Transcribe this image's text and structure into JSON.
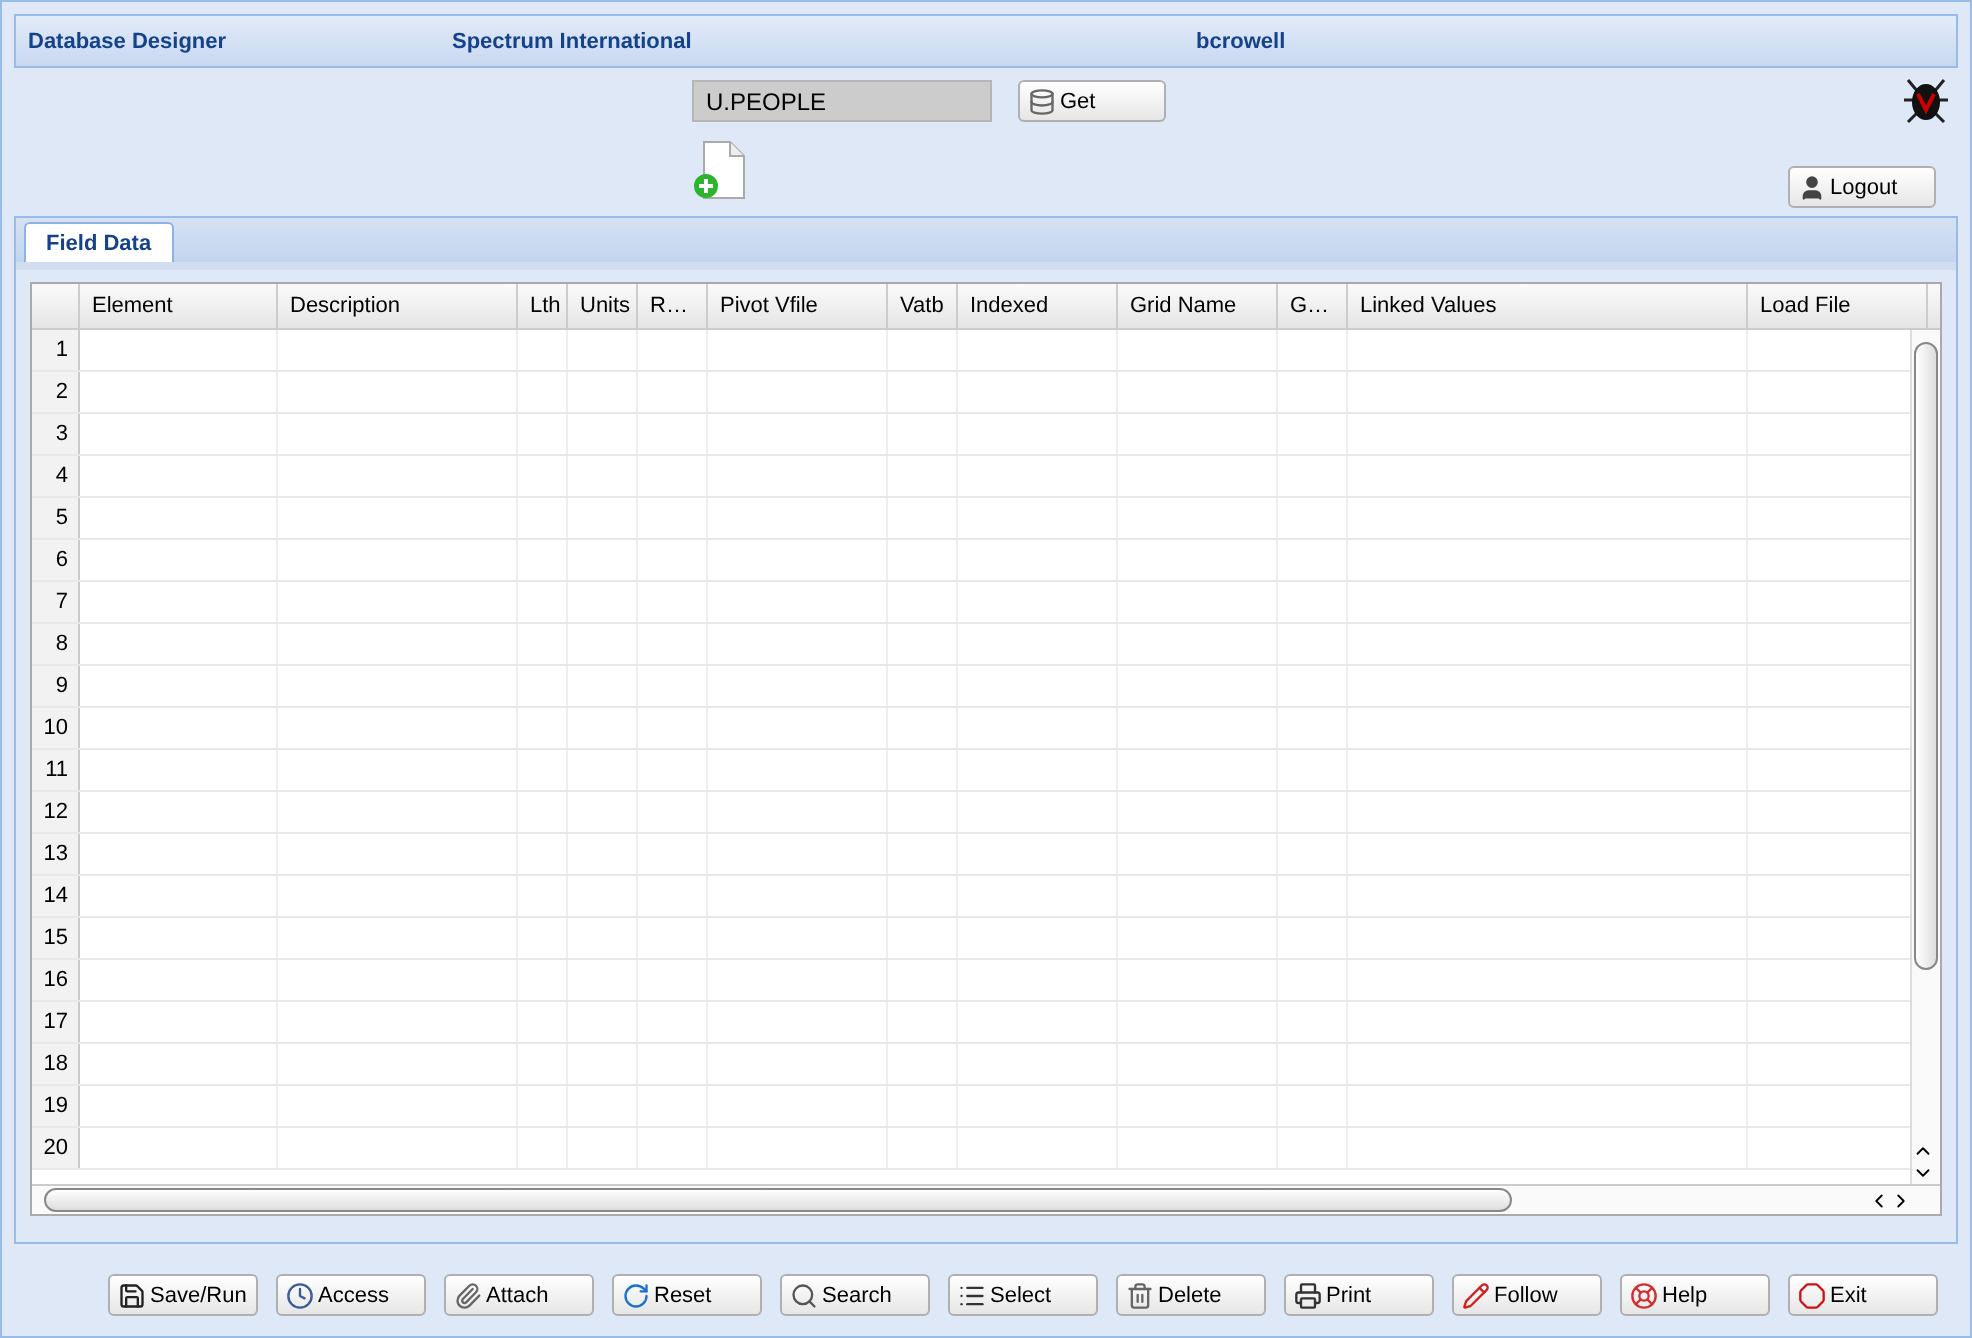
{
  "header": {
    "app": "Database Designer",
    "company": "Spectrum International",
    "user": "bcrowell"
  },
  "file_field": {
    "value": "U.PEOPLE"
  },
  "get_button": "Get",
  "logout_button": "Logout",
  "tabs": [
    {
      "label": "Field Data",
      "selected": true
    }
  ],
  "table": {
    "columns": [
      "Element",
      "Description",
      "Lth",
      "Units",
      "R…",
      "Pivot Vfile",
      "Vatb",
      "Indexed",
      "Grid Name",
      "G…",
      "Linked Values",
      "Load File"
    ],
    "rows": [
      "1",
      "2",
      "3",
      "4",
      "5",
      "6",
      "7",
      "8",
      "9",
      "10",
      "11",
      "12",
      "13",
      "14",
      "15",
      "16",
      "17",
      "18",
      "19",
      "20"
    ]
  },
  "buttons": [
    {
      "label": "Save/Run",
      "kind": "save"
    },
    {
      "label": "Access",
      "kind": "clock"
    },
    {
      "label": "Attach",
      "kind": "clip"
    },
    {
      "label": "Reset",
      "kind": "reset"
    },
    {
      "label": "Search",
      "kind": "search"
    },
    {
      "label": "Select",
      "kind": "list"
    },
    {
      "label": "Delete",
      "kind": "trash"
    },
    {
      "label": "Print",
      "kind": "print"
    },
    {
      "label": "Follow",
      "kind": "pen"
    },
    {
      "label": "Help",
      "kind": "help"
    },
    {
      "label": "Exit",
      "kind": "stop"
    }
  ]
}
